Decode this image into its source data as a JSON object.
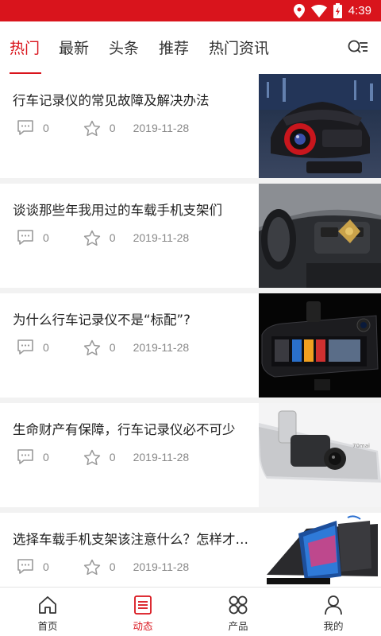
{
  "status_bar": {
    "time": "4:39"
  },
  "tabs": [
    {
      "label": "热门",
      "active": true
    },
    {
      "label": "最新",
      "active": false
    },
    {
      "label": "头条",
      "active": false
    },
    {
      "label": "推荐",
      "active": false
    },
    {
      "label": "热门资讯",
      "active": false
    }
  ],
  "articles": [
    {
      "title": "行车记录仪的常见故障及解决办法",
      "comments": "0",
      "likes": "0",
      "date": "2019-11-28"
    },
    {
      "title": "谈谈那些年我用过的车载手机支架们",
      "comments": "0",
      "likes": "0",
      "date": "2019-11-28"
    },
    {
      "title": "为什么行车记录仪不是“标配”?",
      "comments": "0",
      "likes": "0",
      "date": "2019-11-28"
    },
    {
      "title": "生命财产有保障，行车记录仪必不可少",
      "comments": "0",
      "likes": "0",
      "date": "2019-11-28"
    },
    {
      "title": "选择车载手机支架该注意什么？怎样才…",
      "comments": "0",
      "likes": "0",
      "date": "2019-11-28"
    }
  ],
  "bottom_nav": [
    {
      "label": "首页",
      "icon": "home-icon",
      "active": false
    },
    {
      "label": "动态",
      "icon": "news-icon",
      "active": true
    },
    {
      "label": "产品",
      "icon": "products-icon",
      "active": false
    },
    {
      "label": "我的",
      "icon": "user-icon",
      "active": false
    }
  ],
  "colors": {
    "accent": "#d9141c",
    "text": "#222222",
    "muted": "#888888"
  }
}
